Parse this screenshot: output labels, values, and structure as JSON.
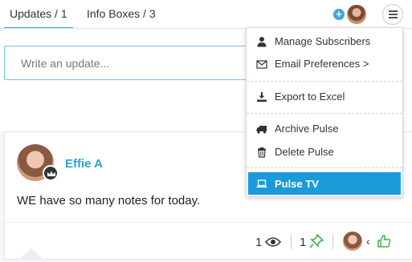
{
  "tabs": [
    {
      "label": "Updates / 1",
      "active": true
    },
    {
      "label": "Info Boxes / 3",
      "active": false
    }
  ],
  "header": {
    "add_icon": "plus-icon",
    "menu_icon": "hamburger-icon"
  },
  "update_input": {
    "placeholder": "Write an update..."
  },
  "post": {
    "author": "Effie A",
    "text": "WE have so many notes for today.",
    "views": "1",
    "pins": "1",
    "reply_chevron": "‹"
  },
  "menu": {
    "items": [
      {
        "label": "Manage Subscribers",
        "icon": "user-icon"
      },
      {
        "label": "Email Preferences >",
        "icon": "envelope-icon"
      },
      {
        "label": "Export to Excel",
        "icon": "download-icon"
      },
      {
        "label": "Archive Pulse",
        "icon": "truck-icon"
      },
      {
        "label": "Delete Pulse",
        "icon": "trash-icon"
      },
      {
        "label": "Pulse TV",
        "icon": "laptop-icon",
        "active": true
      }
    ]
  },
  "colors": {
    "accent": "#2aa2d8",
    "menu_active": "#1a9ad9",
    "like_green": "#3bb54a"
  }
}
